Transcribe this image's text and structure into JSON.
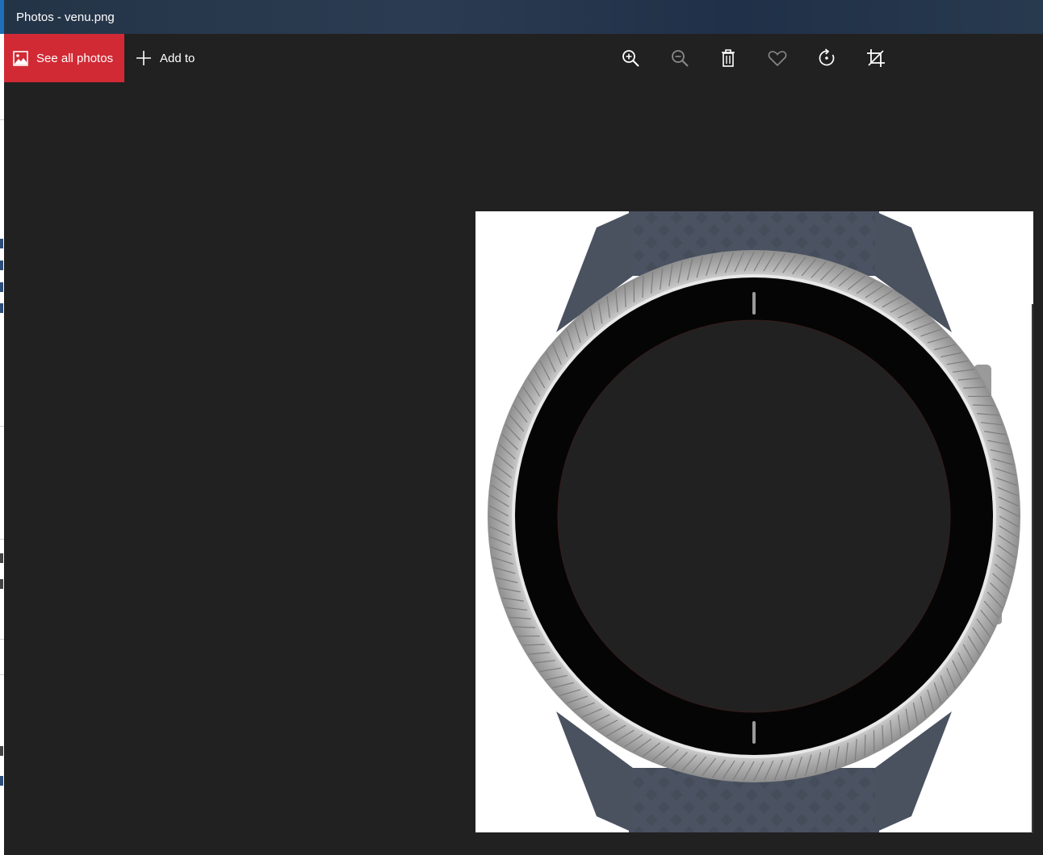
{
  "window": {
    "title": "Photos - venu.png"
  },
  "toolbar": {
    "see_all_label": "See all photos",
    "add_to_label": "Add to",
    "tools": [
      {
        "name": "zoom-in",
        "icon": "zoom-in-icon"
      },
      {
        "name": "zoom-out",
        "icon": "zoom-out-icon"
      },
      {
        "name": "delete",
        "icon": "trash-icon"
      },
      {
        "name": "favorite",
        "icon": "heart-icon"
      },
      {
        "name": "rotate",
        "icon": "rotate-icon"
      },
      {
        "name": "crop",
        "icon": "crop-icon"
      }
    ]
  },
  "image": {
    "subject": "watch-image",
    "background": "#ffffff",
    "strap_color": "#4a5260",
    "bezel_color": "#c0c0c0",
    "screen_color": "#050505",
    "display_color": "#212121"
  },
  "colors": {
    "accent": "#d12a35",
    "app_background": "#212121"
  }
}
